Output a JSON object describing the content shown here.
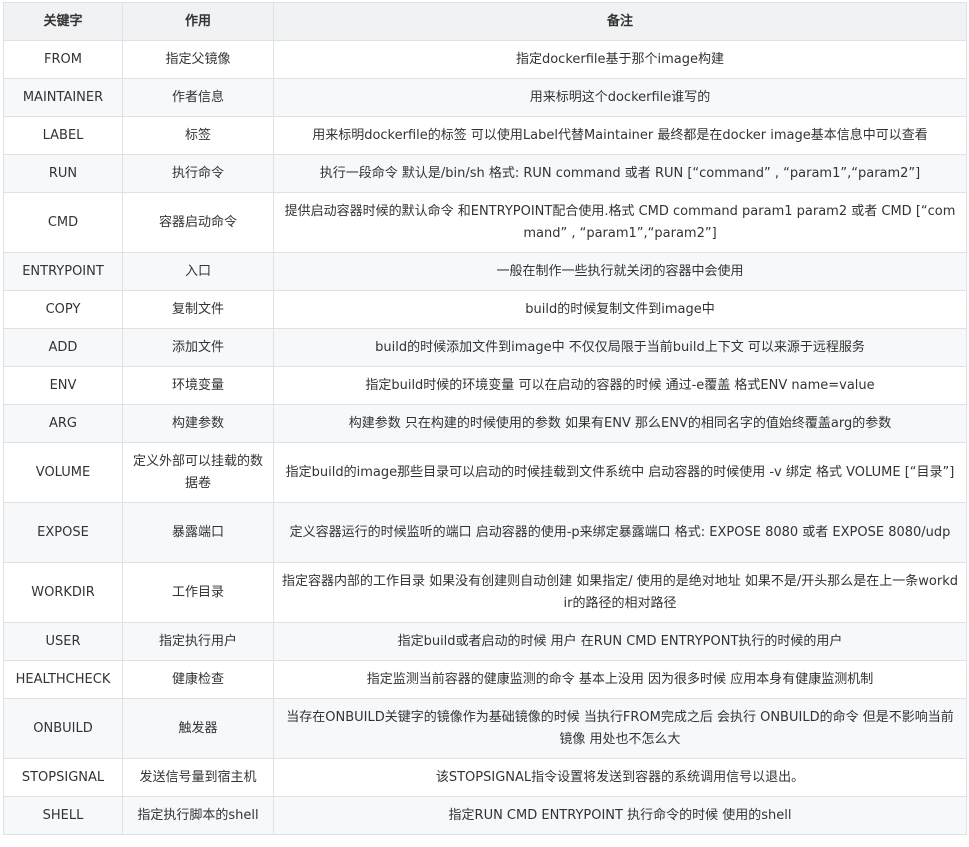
{
  "headers": {
    "keyword": "关键字",
    "purpose": "作用",
    "note": "备注"
  },
  "rows": [
    {
      "keyword": "FROM",
      "purpose": "指定父镜像",
      "note": "指定dockerfile基于那个image构建"
    },
    {
      "keyword": "MAINTAINER",
      "purpose": "作者信息",
      "note": "用来标明这个dockerfile谁写的"
    },
    {
      "keyword": "LABEL",
      "purpose": "标签",
      "note": "用来标明dockerfile的标签 可以使用Label代替Maintainer 最终都是在docker image基本信息中可以查看"
    },
    {
      "keyword": "RUN",
      "purpose": "执行命令",
      "note": "执行一段命令 默认是/bin/sh 格式: RUN command 或者 RUN [“command” , “param1”,“param2”]"
    },
    {
      "keyword": "CMD",
      "purpose": "容器启动命令",
      "note": "提供启动容器时候的默认命令 和ENTRYPOINT配合使用.格式 CMD command param1 param2 或者 CMD [“command” , “param1”,“param2”]"
    },
    {
      "keyword": "ENTRYPOINT",
      "purpose": "入口",
      "note": "一般在制作一些执行就关闭的容器中会使用"
    },
    {
      "keyword": "COPY",
      "purpose": "复制文件",
      "note": "build的时候复制文件到image中"
    },
    {
      "keyword": "ADD",
      "purpose": "添加文件",
      "note": "build的时候添加文件到image中 不仅仅局限于当前build上下文 可以来源于远程服务"
    },
    {
      "keyword": "ENV",
      "purpose": "环境变量",
      "note": "指定build时候的环境变量 可以在启动的容器的时候 通过-e覆盖 格式ENV name=value"
    },
    {
      "keyword": "ARG",
      "purpose": "构建参数",
      "note": "构建参数 只在构建的时候使用的参数 如果有ENV 那么ENV的相同名字的值始终覆盖arg的参数"
    },
    {
      "keyword": "VOLUME",
      "purpose": "定义外部可以挂载的数据卷",
      "note": "指定build的image那些目录可以启动的时候挂载到文件系统中 启动容器的时候使用 -v 绑定 格式 VOLUME [“目录”]"
    },
    {
      "keyword": "EXPOSE",
      "purpose": "暴露端口",
      "note": "定义容器运行的时候监听的端口 启动容器的使用-p来绑定暴露端口 格式: EXPOSE 8080 或者 EXPOSE 8080/udp"
    },
    {
      "keyword": "WORKDIR",
      "purpose": "工作目录",
      "note": "指定容器内部的工作目录 如果没有创建则自动创建 如果指定/ 使用的是绝对地址 如果不是/开头那么是在上一条workdir的路径的相对路径"
    },
    {
      "keyword": "USER",
      "purpose": "指定执行用户",
      "note": "指定build或者启动的时候 用户 在RUN CMD ENTRYPONT执行的时候的用户"
    },
    {
      "keyword": "HEALTHCHECK",
      "purpose": "健康检查",
      "note": "指定监测当前容器的健康监测的命令 基本上没用 因为很多时候 应用本身有健康监测机制"
    },
    {
      "keyword": "ONBUILD",
      "purpose": "触发器",
      "note": "当存在ONBUILD关键字的镜像作为基础镜像的时候 当执行FROM完成之后 会执行 ONBUILD的命令 但是不影响当前镜像 用处也不怎么大"
    },
    {
      "keyword": "STOPSIGNAL",
      "purpose": "发送信号量到宿主机",
      "note": "该STOPSIGNAL指令设置将发送到容器的系统调用信号以退出。"
    },
    {
      "keyword": "SHELL",
      "purpose": "指定执行脚本的shell",
      "note": "指定RUN CMD ENTRYPOINT 执行命令的时候 使用的shell"
    }
  ]
}
